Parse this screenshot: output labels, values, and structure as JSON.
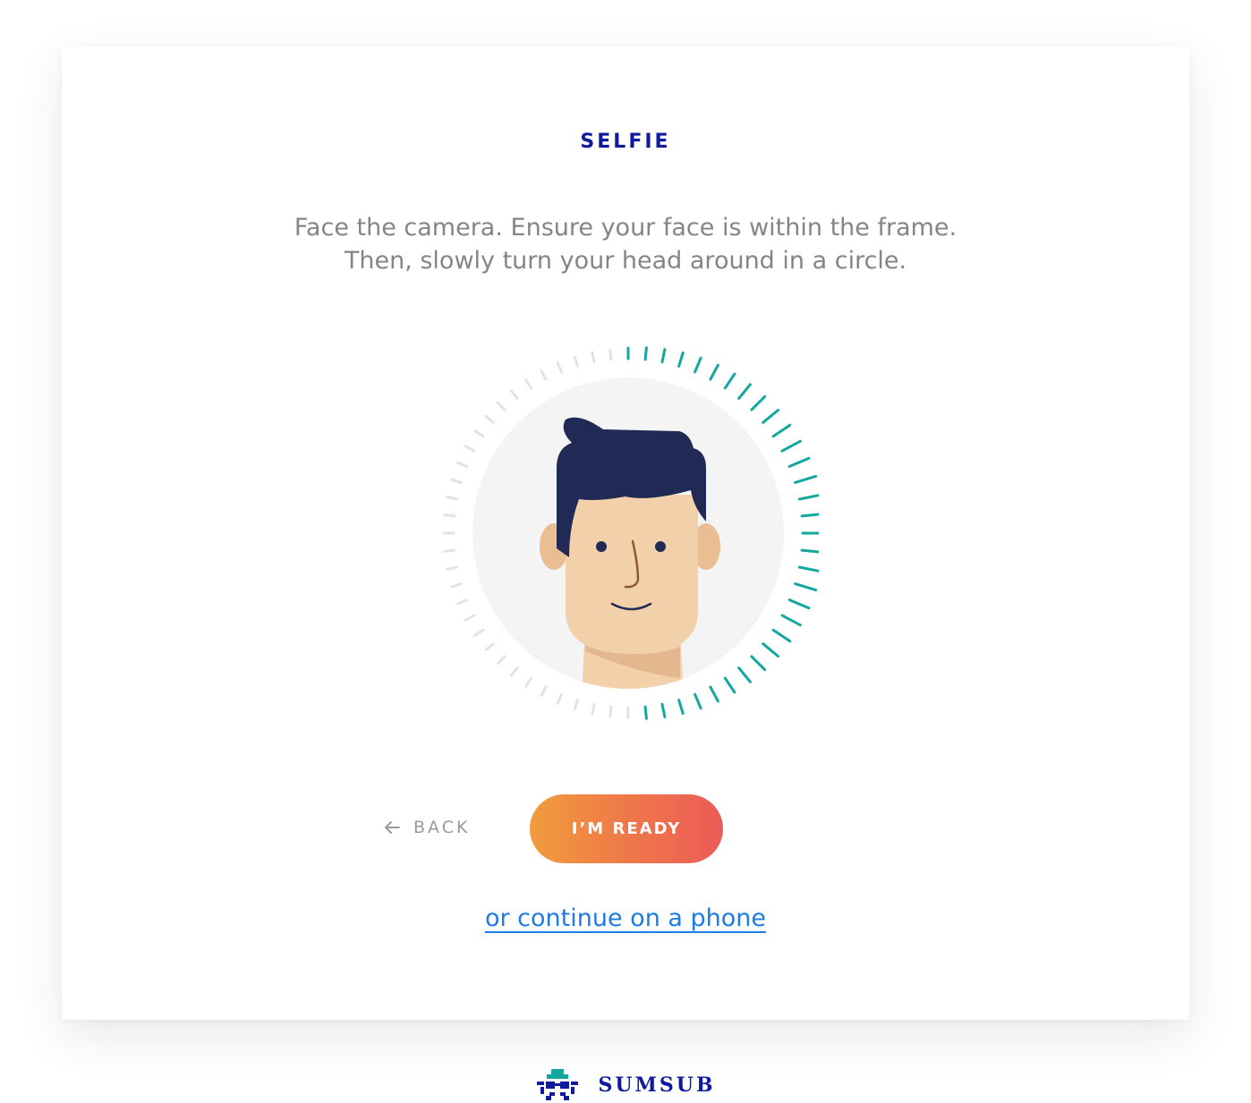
{
  "page": {
    "title": "SELFIE",
    "instructions": [
      "Face the camera. Ensure your face is within the frame.",
      "Then, slowly turn your head around in a circle."
    ]
  },
  "illustration": {
    "progress": 0.5,
    "colors": {
      "tick_done": "#12a8a0",
      "tick_pending": "#e3e3e3",
      "circle_bg": "#f4f4f5",
      "hair": "#202a55",
      "skin": "#f2d0aa",
      "skin_shadow": "#e3b88f",
      "ear": "#ebbd92"
    }
  },
  "actions": {
    "back_label": "BACK",
    "back_icon": "arrow-left-icon",
    "ready_label": "I’M READY",
    "phone_link": "or continue on a phone"
  },
  "brand": {
    "name": "SUMSUB",
    "logo_icon": "sumsub-logo-icon"
  },
  "colors": {
    "title": "#0f1a9c",
    "text": "#858585",
    "link": "#1e7ae6",
    "button_gradient_start": "#f19c3d",
    "button_gradient_end": "#ec5a57"
  }
}
